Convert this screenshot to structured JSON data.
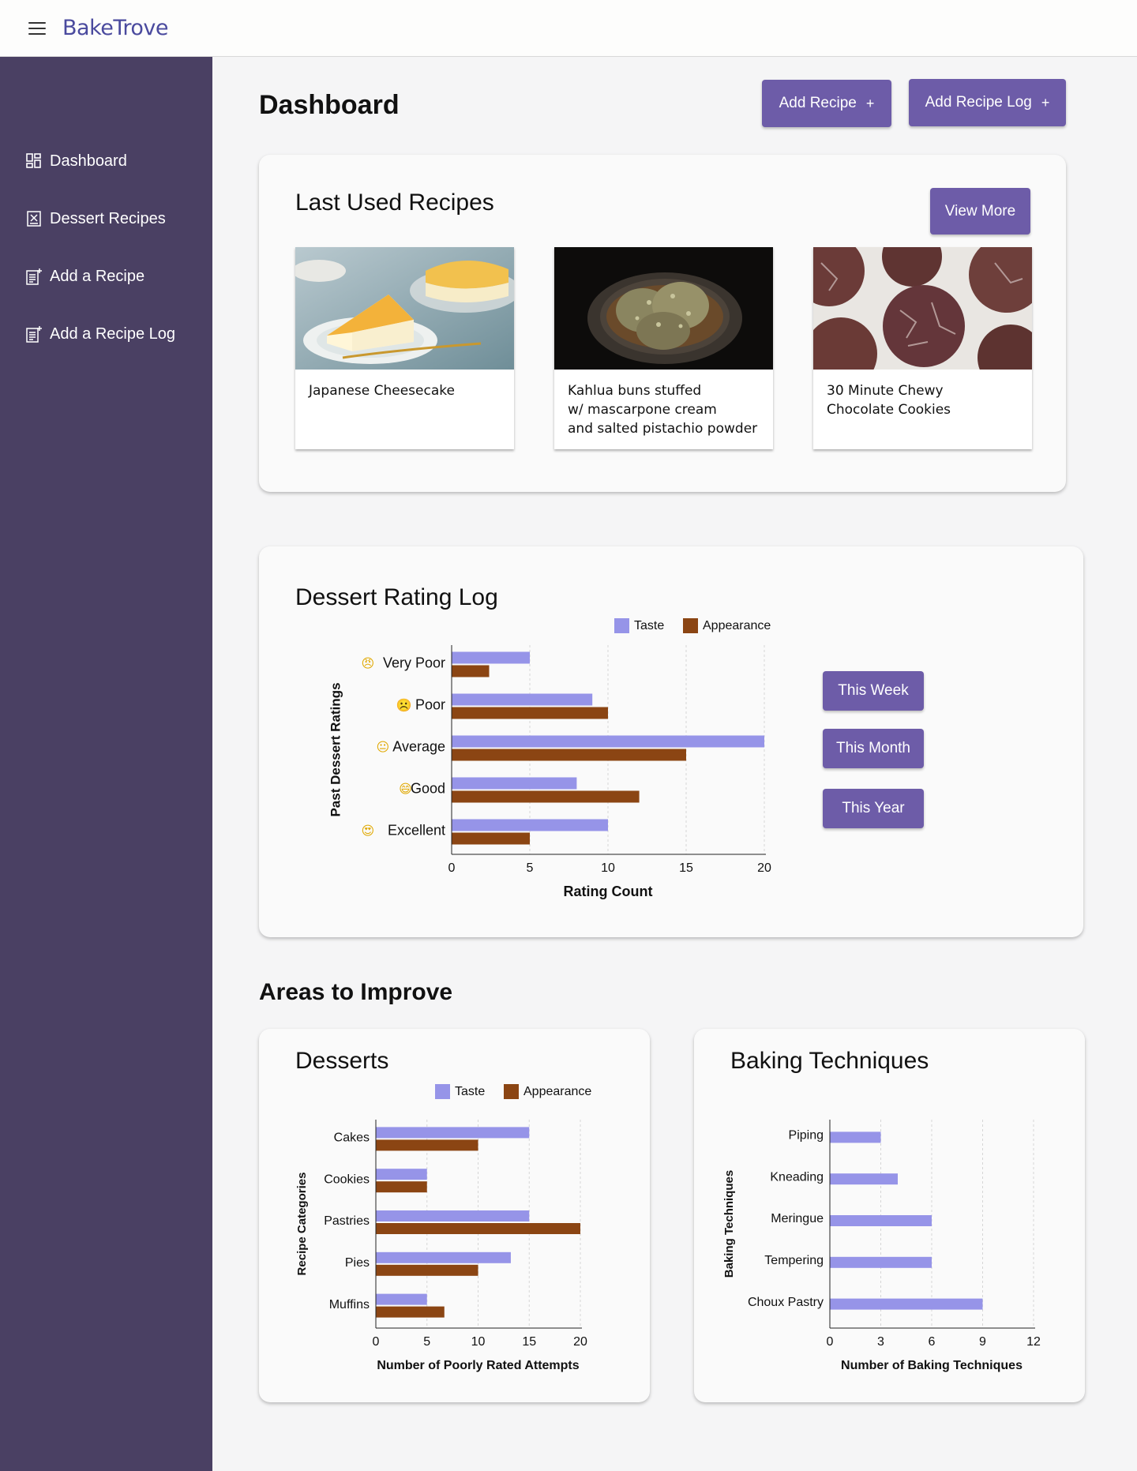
{
  "app": {
    "brand": "BakeTrove"
  },
  "sidebar": {
    "items": [
      {
        "label": "Dashboard",
        "icon": "dashboard-grid-icon"
      },
      {
        "label": "Dessert Recipes",
        "icon": "recipe-book-icon"
      },
      {
        "label": "Add a Recipe",
        "icon": "add-document-icon"
      },
      {
        "label": "Add a Recipe Log",
        "icon": "add-document-icon"
      }
    ]
  },
  "header": {
    "title": "Dashboard",
    "add_recipe_label": "Add Recipe",
    "add_recipe_log_label": "Add Recipe Log",
    "plus": "+"
  },
  "last_used": {
    "title": "Last Used Recipes",
    "view_more_label": "View More",
    "recipes": [
      {
        "name": "Japanese Cheesecake"
      },
      {
        "name": "Kahlua buns stuffed\nw/ mascarpone cream\nand salted pistachio powder"
      },
      {
        "name": "30 Minute Chewy\nChocolate Cookies"
      }
    ]
  },
  "rating_log": {
    "title": "Dessert Rating Log",
    "range_buttons": [
      "This Week",
      "This Month",
      "This Year"
    ]
  },
  "areas": {
    "heading": "Areas to Improve",
    "desserts_title": "Desserts",
    "techniques_title": "Baking Techniques"
  },
  "colors": {
    "taste": "#9694e8",
    "appearance": "#8b4513",
    "accent": "#6d5ca8",
    "sidebar": "#4a4063"
  },
  "chart_data": [
    {
      "type": "bar",
      "orientation": "horizontal",
      "categories": [
        "Very Poor",
        "Poor",
        "Average",
        "Good",
        "Excellent"
      ],
      "category_icons": [
        "😠",
        "☹️",
        "😐",
        "😄",
        "😍"
      ],
      "series": [
        {
          "name": "Taste",
          "values": [
            5,
            9,
            20,
            8,
            10
          ]
        },
        {
          "name": "Appearance",
          "values": [
            2.4,
            10,
            15,
            12,
            5
          ]
        }
      ],
      "xlabel": "Rating Count",
      "ylabel": "Past Dessert Ratings",
      "xlim": [
        0,
        20
      ],
      "xticks": [
        0,
        5,
        10,
        15,
        20
      ],
      "grid": true,
      "legend": "top"
    },
    {
      "type": "bar",
      "orientation": "horizontal",
      "categories": [
        "Cakes",
        "Cookies",
        "Pastries",
        "Pies",
        "Muffins"
      ],
      "series": [
        {
          "name": "Taste",
          "values": [
            15,
            5,
            15,
            13.2,
            5
          ]
        },
        {
          "name": "Appearance",
          "values": [
            10,
            5,
            20,
            10,
            6.7
          ]
        }
      ],
      "xlabel": "Number of Poorly Rated Attempts",
      "ylabel": "Recipe Categories",
      "xlim": [
        0,
        20
      ],
      "xticks": [
        0,
        5,
        10,
        15,
        20
      ],
      "grid": true,
      "legend": "top"
    },
    {
      "type": "bar",
      "orientation": "horizontal",
      "categories": [
        "Piping",
        "Kneading",
        "Meringue",
        "Tempering",
        "Choux Pastry"
      ],
      "series": [
        {
          "values": [
            3,
            4,
            6,
            6,
            9
          ]
        }
      ],
      "xlabel": "Number of Baking Techniques",
      "ylabel": "Baking Techniques",
      "xlim": [
        0,
        12
      ],
      "xticks": [
        0,
        3,
        6,
        9,
        12
      ],
      "grid": true
    }
  ]
}
